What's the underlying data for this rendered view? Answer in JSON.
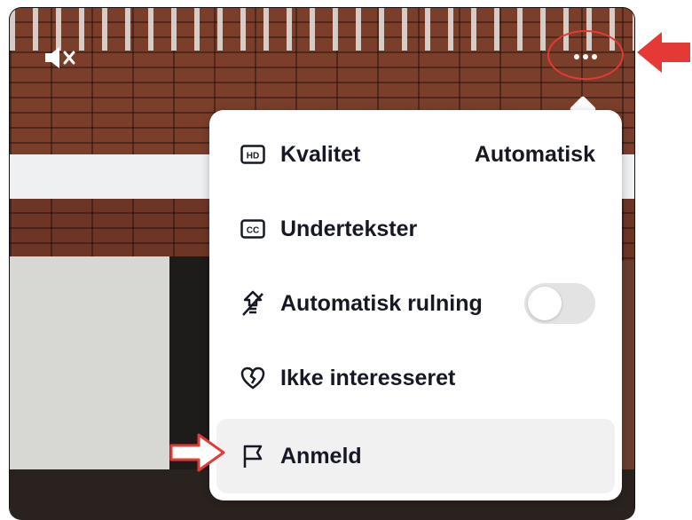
{
  "menu": {
    "items": [
      {
        "label": "Kvalitet",
        "value": "Automatisk",
        "icon": "hd-icon"
      },
      {
        "label": "Undertekster",
        "icon": "cc-icon"
      },
      {
        "label": "Automatisk rulning",
        "icon": "autoscroll-icon",
        "toggle": false
      },
      {
        "label": "Ikke interesseret",
        "icon": "broken-heart-icon"
      },
      {
        "label": "Anmeld",
        "icon": "flag-icon"
      }
    ]
  },
  "annotation_color": "#e53935",
  "controls": {
    "mute_icon": "speaker-muted-icon",
    "more_icon": "more-options-icon"
  }
}
